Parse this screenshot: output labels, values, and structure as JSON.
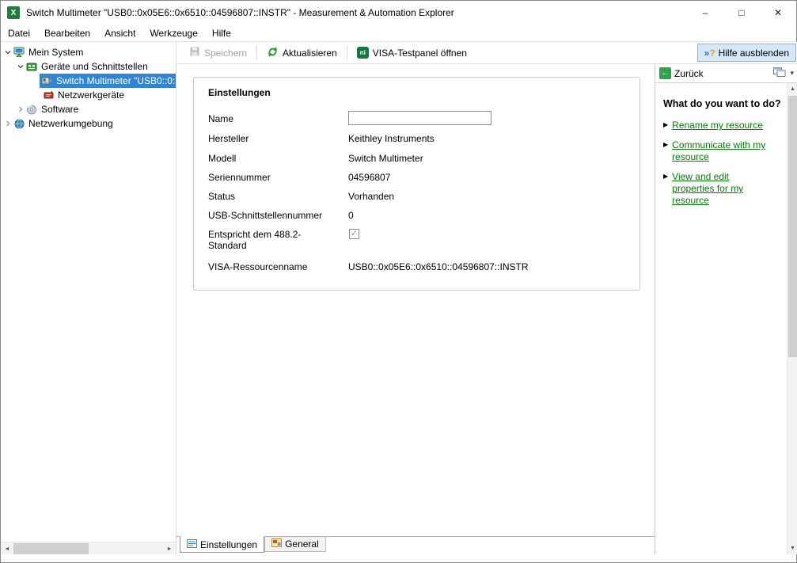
{
  "window": {
    "title": "Switch Multimeter \"USB0::0x05E6::0x6510::04596807::INSTR\" - Measurement & Automation Explorer"
  },
  "icons": {
    "app_glyph": "X",
    "minimize": "–",
    "maximize": "□",
    "close": "✕",
    "scroll_up": "▲",
    "scroll_down": "▼",
    "scroll_left": "◄",
    "scroll_right": "►",
    "dropdown": "▾",
    "back_arrow": "←",
    "link_bullet": "▶",
    "check": "✓",
    "help_arrows": "»",
    "help_q": "?",
    "ni_logo": "ni"
  },
  "menu": {
    "items": [
      "Datei",
      "Bearbeiten",
      "Ansicht",
      "Werkzeuge",
      "Hilfe"
    ]
  },
  "toolbar": {
    "save_label": "Speichern",
    "refresh_label": "Aktualisieren",
    "visa_label": "VISA-Testpanel öffnen",
    "help_toggle_label": "Hilfe ausblenden"
  },
  "tree": {
    "items": [
      {
        "label": "Mein System",
        "state": "expanded"
      },
      {
        "label": "Geräte und Schnittstellen",
        "state": "expanded"
      },
      {
        "label": "Switch Multimeter \"USB0::0:",
        "state": "selected"
      },
      {
        "label": "Netzwerkgeräte",
        "state": "leaf"
      },
      {
        "label": "Software",
        "state": "collapsed"
      },
      {
        "label": "Netzwerkumgebung",
        "state": "collapsed"
      }
    ]
  },
  "settings": {
    "group_title": "Einstellungen",
    "fields": [
      {
        "label": "Name",
        "value": "",
        "type": "input"
      },
      {
        "label": "Hersteller",
        "value": "Keithley Instruments"
      },
      {
        "label": "Modell",
        "value": "Switch Multimeter"
      },
      {
        "label": "Seriennummer",
        "value": "04596807"
      },
      {
        "label": "Status",
        "value": "Vorhanden"
      },
      {
        "label": "USB-Schnittstellennummer",
        "value": "0"
      },
      {
        "label": "Entspricht dem 488.2-Standard",
        "type": "checkbox",
        "checked": true
      },
      {
        "label": "VISA-Ressourcenname",
        "value": "USB0::0x05E6::0x6510::04596807::INSTR"
      }
    ]
  },
  "tabs": {
    "settings_label": "Einstellungen",
    "general_label": "General"
  },
  "help": {
    "back_label": "Zurück",
    "heading": "What do you want to do?",
    "links": [
      "Rename my resource",
      "Communicate with my resource",
      "View and edit properties for my resource"
    ]
  },
  "colors": {
    "selection_blue": "#2f86d6",
    "link_green": "#077a07",
    "help_toggle_bg": "#d5e8f8",
    "ni_green": "#0e7a3e"
  }
}
